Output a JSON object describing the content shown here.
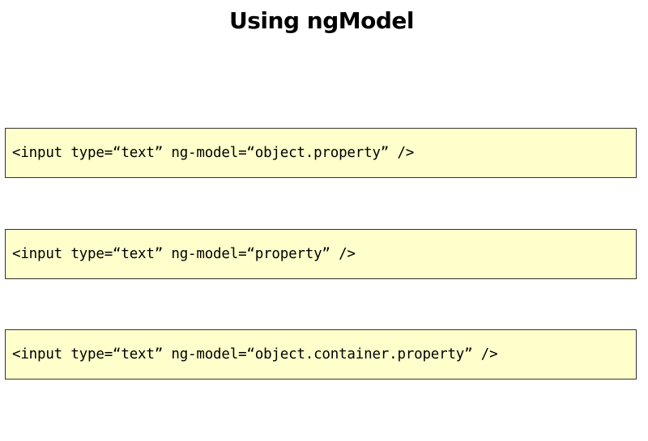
{
  "title": "Using ngModel",
  "code_examples": [
    {
      "code": "<input type=“text” ng-model=“object.property” />"
    },
    {
      "code": "<input type=“text” ng-model=“property” />"
    },
    {
      "code": "<input type=“text” ng-model=“object.container.property” />"
    }
  ],
  "colors": {
    "code_box_background": "#ffffcc",
    "code_box_border": "#333333",
    "text": "#000000"
  }
}
